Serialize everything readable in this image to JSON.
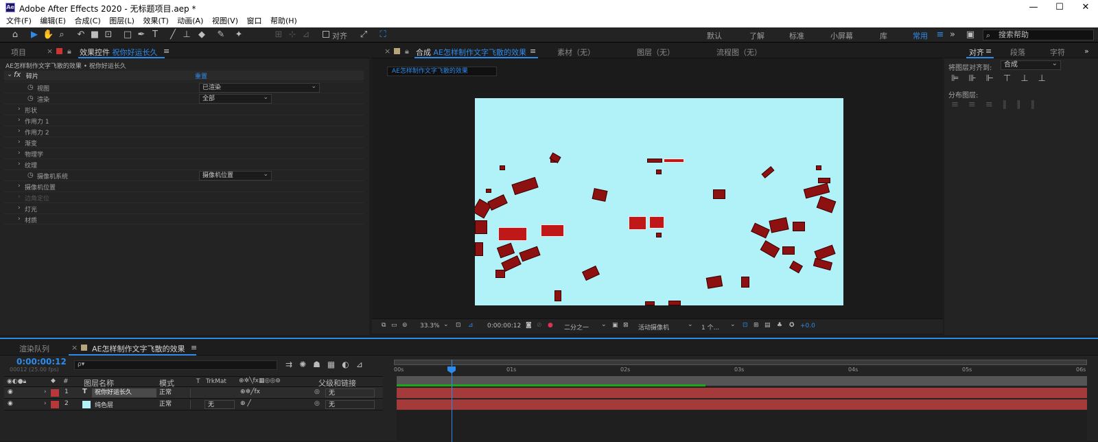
{
  "titlebar": {
    "app_icon_text": "Ae",
    "title": "Adobe After Effects 2020 - 无标题项目.aep *",
    "minimize": "—",
    "maximize": "☐",
    "close": "✕"
  },
  "menu": [
    "文件(F)",
    "编辑(E)",
    "合成(C)",
    "图层(L)",
    "效果(T)",
    "动画(A)",
    "视图(V)",
    "窗口",
    "帮助(H)"
  ],
  "toolbar": {
    "align_label": "对齐"
  },
  "workspaces": [
    "默认",
    "了解",
    "标准",
    "小屏幕",
    "库",
    "常用"
  ],
  "workspace_active": "常用",
  "search_help": "搜索帮助",
  "left_panel": {
    "tab_project": "项目",
    "tab_effects_prefix": "效果控件",
    "tab_effects_layer": "祝你好运长久",
    "breadcrumb": "AE怎样制作文字飞散的效果 • 祝你好运长久",
    "effect_name": "碎片",
    "reset_label": "重置",
    "view_label": "视图",
    "view_value": "已渲染",
    "render_label": "渲染",
    "render_value": "全部",
    "shape": "形状",
    "force1": "作用力 1",
    "force2": "作用力 2",
    "gradient": "渐变",
    "physics": "物理学",
    "texture": "纹理",
    "camera_system_label": "摄像机系统",
    "camera_system_value": "摄像机位置",
    "camera_position": "摄像机位置",
    "corner_pin": "边角定位",
    "lighting": "灯光",
    "material": "材质"
  },
  "comp_panel": {
    "tab_prefix": "合成",
    "tab_comp_name": "AE怎样制作文字飞散的效果",
    "tab_footage": "素材（无）",
    "tab_layer": "图层（无）",
    "tab_flowchart": "流程图（无）",
    "comp_button": "AE怎样制作文字飞散的效果",
    "zoom": "33.3%",
    "timecode": "0:00:00:12",
    "resolution": "二分之一",
    "camera": "活动摄像机",
    "views": "1 个...",
    "exposure": "+0.0"
  },
  "right_panel": {
    "tab_align": "对齐",
    "tab_paragraph": "段落",
    "tab_character": "字符",
    "align_to_label": "将图层对齐到:",
    "align_to_value": "合成",
    "distribute_label": "分布图层:"
  },
  "timeline": {
    "tab_render_queue": "渲染队列",
    "tab_comp": "AE怎样制作文字飞散的效果",
    "timecode": "0:00:00:12",
    "fps": "00012 (25.00 fps)",
    "search_placeholder": "ρ▾",
    "col_num": "#",
    "col_layer_name": "图层名称",
    "col_mode": "模式",
    "col_t": "T",
    "col_trkmat": "TrkMat",
    "col_parent": "父级和链接",
    "ruler": [
      "00s",
      "01s",
      "02s",
      "03s",
      "04s",
      "05s",
      "06s"
    ],
    "layers": [
      {
        "num": "1",
        "type_icon": "T",
        "name": "祝你好运长久",
        "mode": "正常",
        "trkmat": "",
        "parent": "无",
        "color": "#b5383b"
      },
      {
        "num": "2",
        "type_icon": "",
        "name": "纯色层",
        "mode": "正常",
        "trkmat": "无",
        "parent": "无",
        "color": "#b5383b"
      }
    ]
  },
  "colors": {
    "accent": "#2d8ceb",
    "comp_bg": "#b0f2f8",
    "layer_bar": "#a43a3a",
    "shard": "#8e1111"
  }
}
